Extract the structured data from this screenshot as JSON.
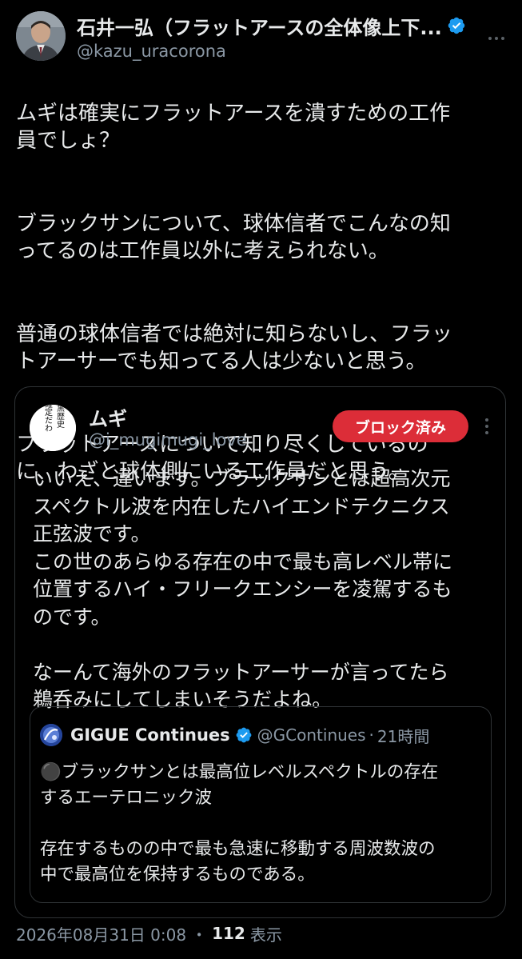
{
  "tweet": {
    "author_name": "石井一弘（フラットアースの全体像上下...",
    "author_handle": "@kazu_uracorona",
    "verified_icon": "verified-badge-icon",
    "more_icon": "more-options-icon",
    "paragraphs": [
      "ムギは確実にフラットアースを潰すための工作\n員でしょ？",
      "ブラックサンについて、球体信者でこんなの知\nってるのは工作員以外に考えられない。",
      "普通の球体信者では絶対に知らないし、フラッ\nトアーサーでも知ってる人は少ないと思う。",
      "フラットアースについて知り尽くしているの\nに、わざと球体側にいる工作員だと思う。"
    ],
    "timestamp": "2026年08月31日 0:08",
    "separator": "・",
    "views_count": "112",
    "views_label": "表示"
  },
  "quote": {
    "author_name": "ムギ",
    "author_handle": "@i_mugimugi_love",
    "avatar_text": [
      "黒歴史",
      "確定だわ"
    ],
    "blocked_label": "ブロック済み",
    "text_lines": [
      "いいえ、違います。ブラックサンとは超高次元",
      "スペクトル波を内在したハイエンドテクニクス",
      "正弦波です。",
      "この世のあらゆる存在の中で最も高レベル帯に",
      "位置するハイ・フリークエンシーを凌駕するも",
      "のです。",
      "",
      "なーんて海外のフラットアーサーが言ってたら",
      "鵜呑みにしてしまいそうだよね。"
    ],
    "inner": {
      "author_name": "GIGUE Continues",
      "author_handle": "@GContinues",
      "separator": "·",
      "time": "21時間",
      "text_lines": [
        "⚫️ブラックサンとは最高位レベルスペクトルの存在",
        "するエーテロニック波",
        "",
        "存在するものの中で最も急速に移動する周波数波の",
        "中で最高位を保持するものである。"
      ]
    }
  },
  "colors": {
    "background": "#000000",
    "text": "#e7e9ea",
    "secondary_text": "#8b98a5",
    "border": "#2f3336",
    "verified_blue": "#1d9bf0",
    "blocked_red": "#dc2d38"
  }
}
